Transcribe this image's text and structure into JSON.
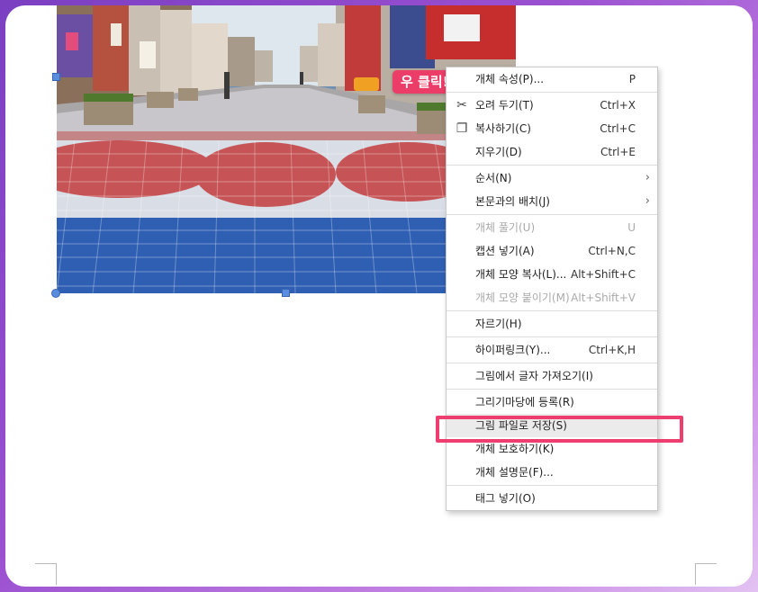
{
  "badge": {
    "label": "우 클릭!"
  },
  "menu": {
    "items": [
      {
        "label": "개체 속성(P)...",
        "shortcut": "P",
        "icon": "",
        "disabled": false
      },
      {
        "sep": true
      },
      {
        "label": "오려 두기(T)",
        "shortcut": "Ctrl+X",
        "icon": "scissors-icon",
        "disabled": false
      },
      {
        "label": "복사하기(C)",
        "shortcut": "Ctrl+C",
        "icon": "copy-icon",
        "disabled": false
      },
      {
        "label": "지우기(D)",
        "shortcut": "Ctrl+E",
        "icon": "",
        "disabled": false
      },
      {
        "sep": true
      },
      {
        "label": "순서(N)",
        "shortcut": "",
        "submenu": true,
        "disabled": false
      },
      {
        "label": "본문과의 배치(J)",
        "shortcut": "",
        "submenu": true,
        "disabled": false
      },
      {
        "sep": true
      },
      {
        "label": "개체 풀기(U)",
        "shortcut": "U",
        "disabled": true
      },
      {
        "label": "캡션 넣기(A)",
        "shortcut": "Ctrl+N,C",
        "disabled": false
      },
      {
        "label": "개체 모양 복사(L)...",
        "shortcut": "Alt+Shift+C",
        "disabled": false
      },
      {
        "label": "개체 모양 붙이기(M)",
        "shortcut": "Alt+Shift+V",
        "disabled": true
      },
      {
        "sep": true
      },
      {
        "label": "자르기(H)",
        "shortcut": "",
        "disabled": false
      },
      {
        "sep": true
      },
      {
        "label": "하이퍼링크(Y)...",
        "shortcut": "Ctrl+K,H",
        "disabled": false
      },
      {
        "sep": true
      },
      {
        "label": "그림에서 글자 가져오기(I)",
        "shortcut": "",
        "disabled": false
      },
      {
        "sep": true
      },
      {
        "label": "그리기마당에 등록(R)",
        "shortcut": "",
        "disabled": false
      },
      {
        "label": "그림 파일로 저장(S)",
        "shortcut": "",
        "disabled": false,
        "highlighted": true
      },
      {
        "label": "개체 보호하기(K)",
        "shortcut": "",
        "disabled": false
      },
      {
        "label": "개체 설명문(F)...",
        "shortcut": "",
        "disabled": false
      },
      {
        "sep": true
      },
      {
        "label": "태그 넣기(O)",
        "shortcut": "",
        "disabled": false
      }
    ]
  },
  "colors": {
    "accent": "#ee3d6f",
    "badge": "#ec3c68",
    "handle": "#5b8ddf"
  }
}
